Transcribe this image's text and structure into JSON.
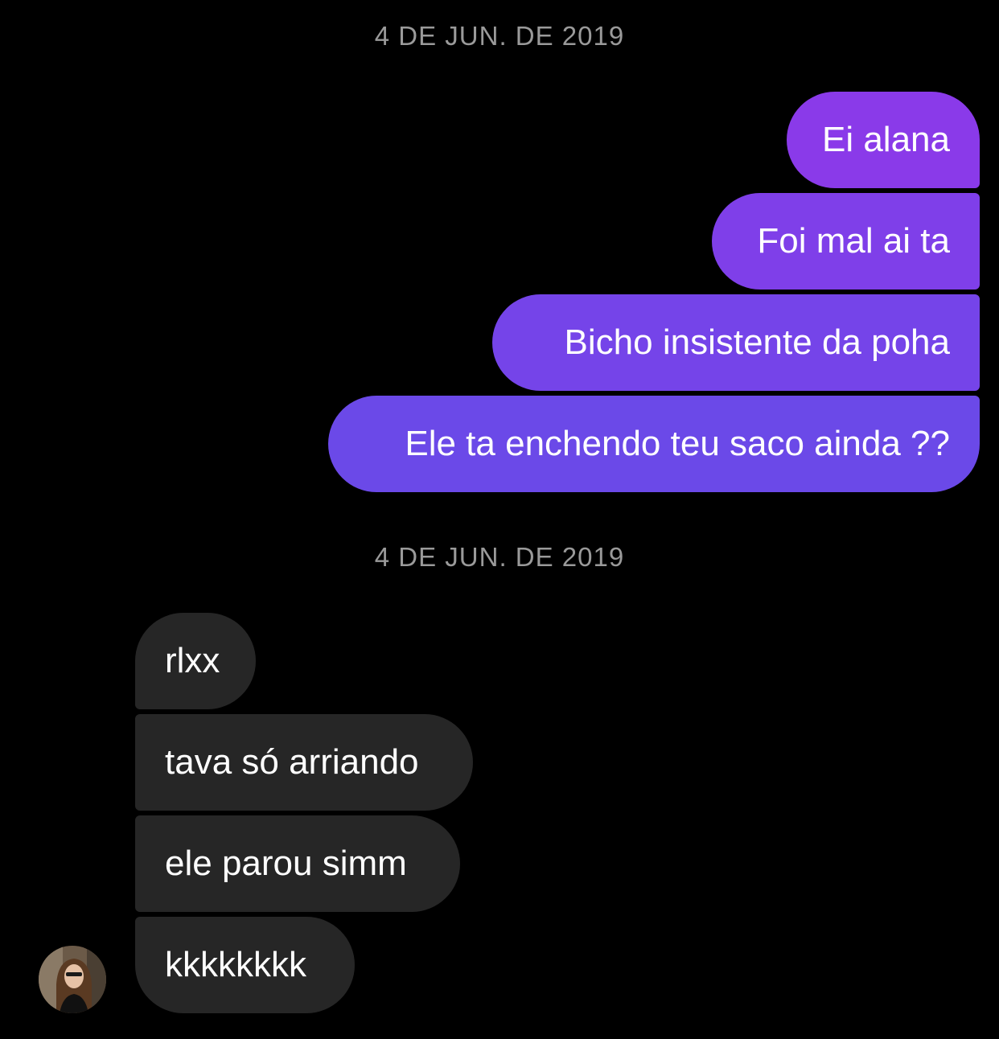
{
  "conversation": {
    "timestamps": [
      "4 DE JUN. DE 2019",
      "4 DE JUN. DE 2019"
    ],
    "sent_messages": [
      "Ei alana",
      "Foi mal ai ta",
      "Bicho insistente da poha",
      "Ele ta enchendo teu saco ainda ??"
    ],
    "received_messages": [
      "rlxx",
      "tava só arriando",
      "ele parou simm",
      "kkkkkkkk"
    ]
  },
  "colors": {
    "background": "#000000",
    "sent_bubble_top": "#8a3ae9",
    "sent_bubble_bottom": "#6b49e8",
    "received_bubble": "#262626",
    "timestamp_text": "#9a9a9a"
  },
  "icons": {
    "avatar": "contact-avatar"
  }
}
